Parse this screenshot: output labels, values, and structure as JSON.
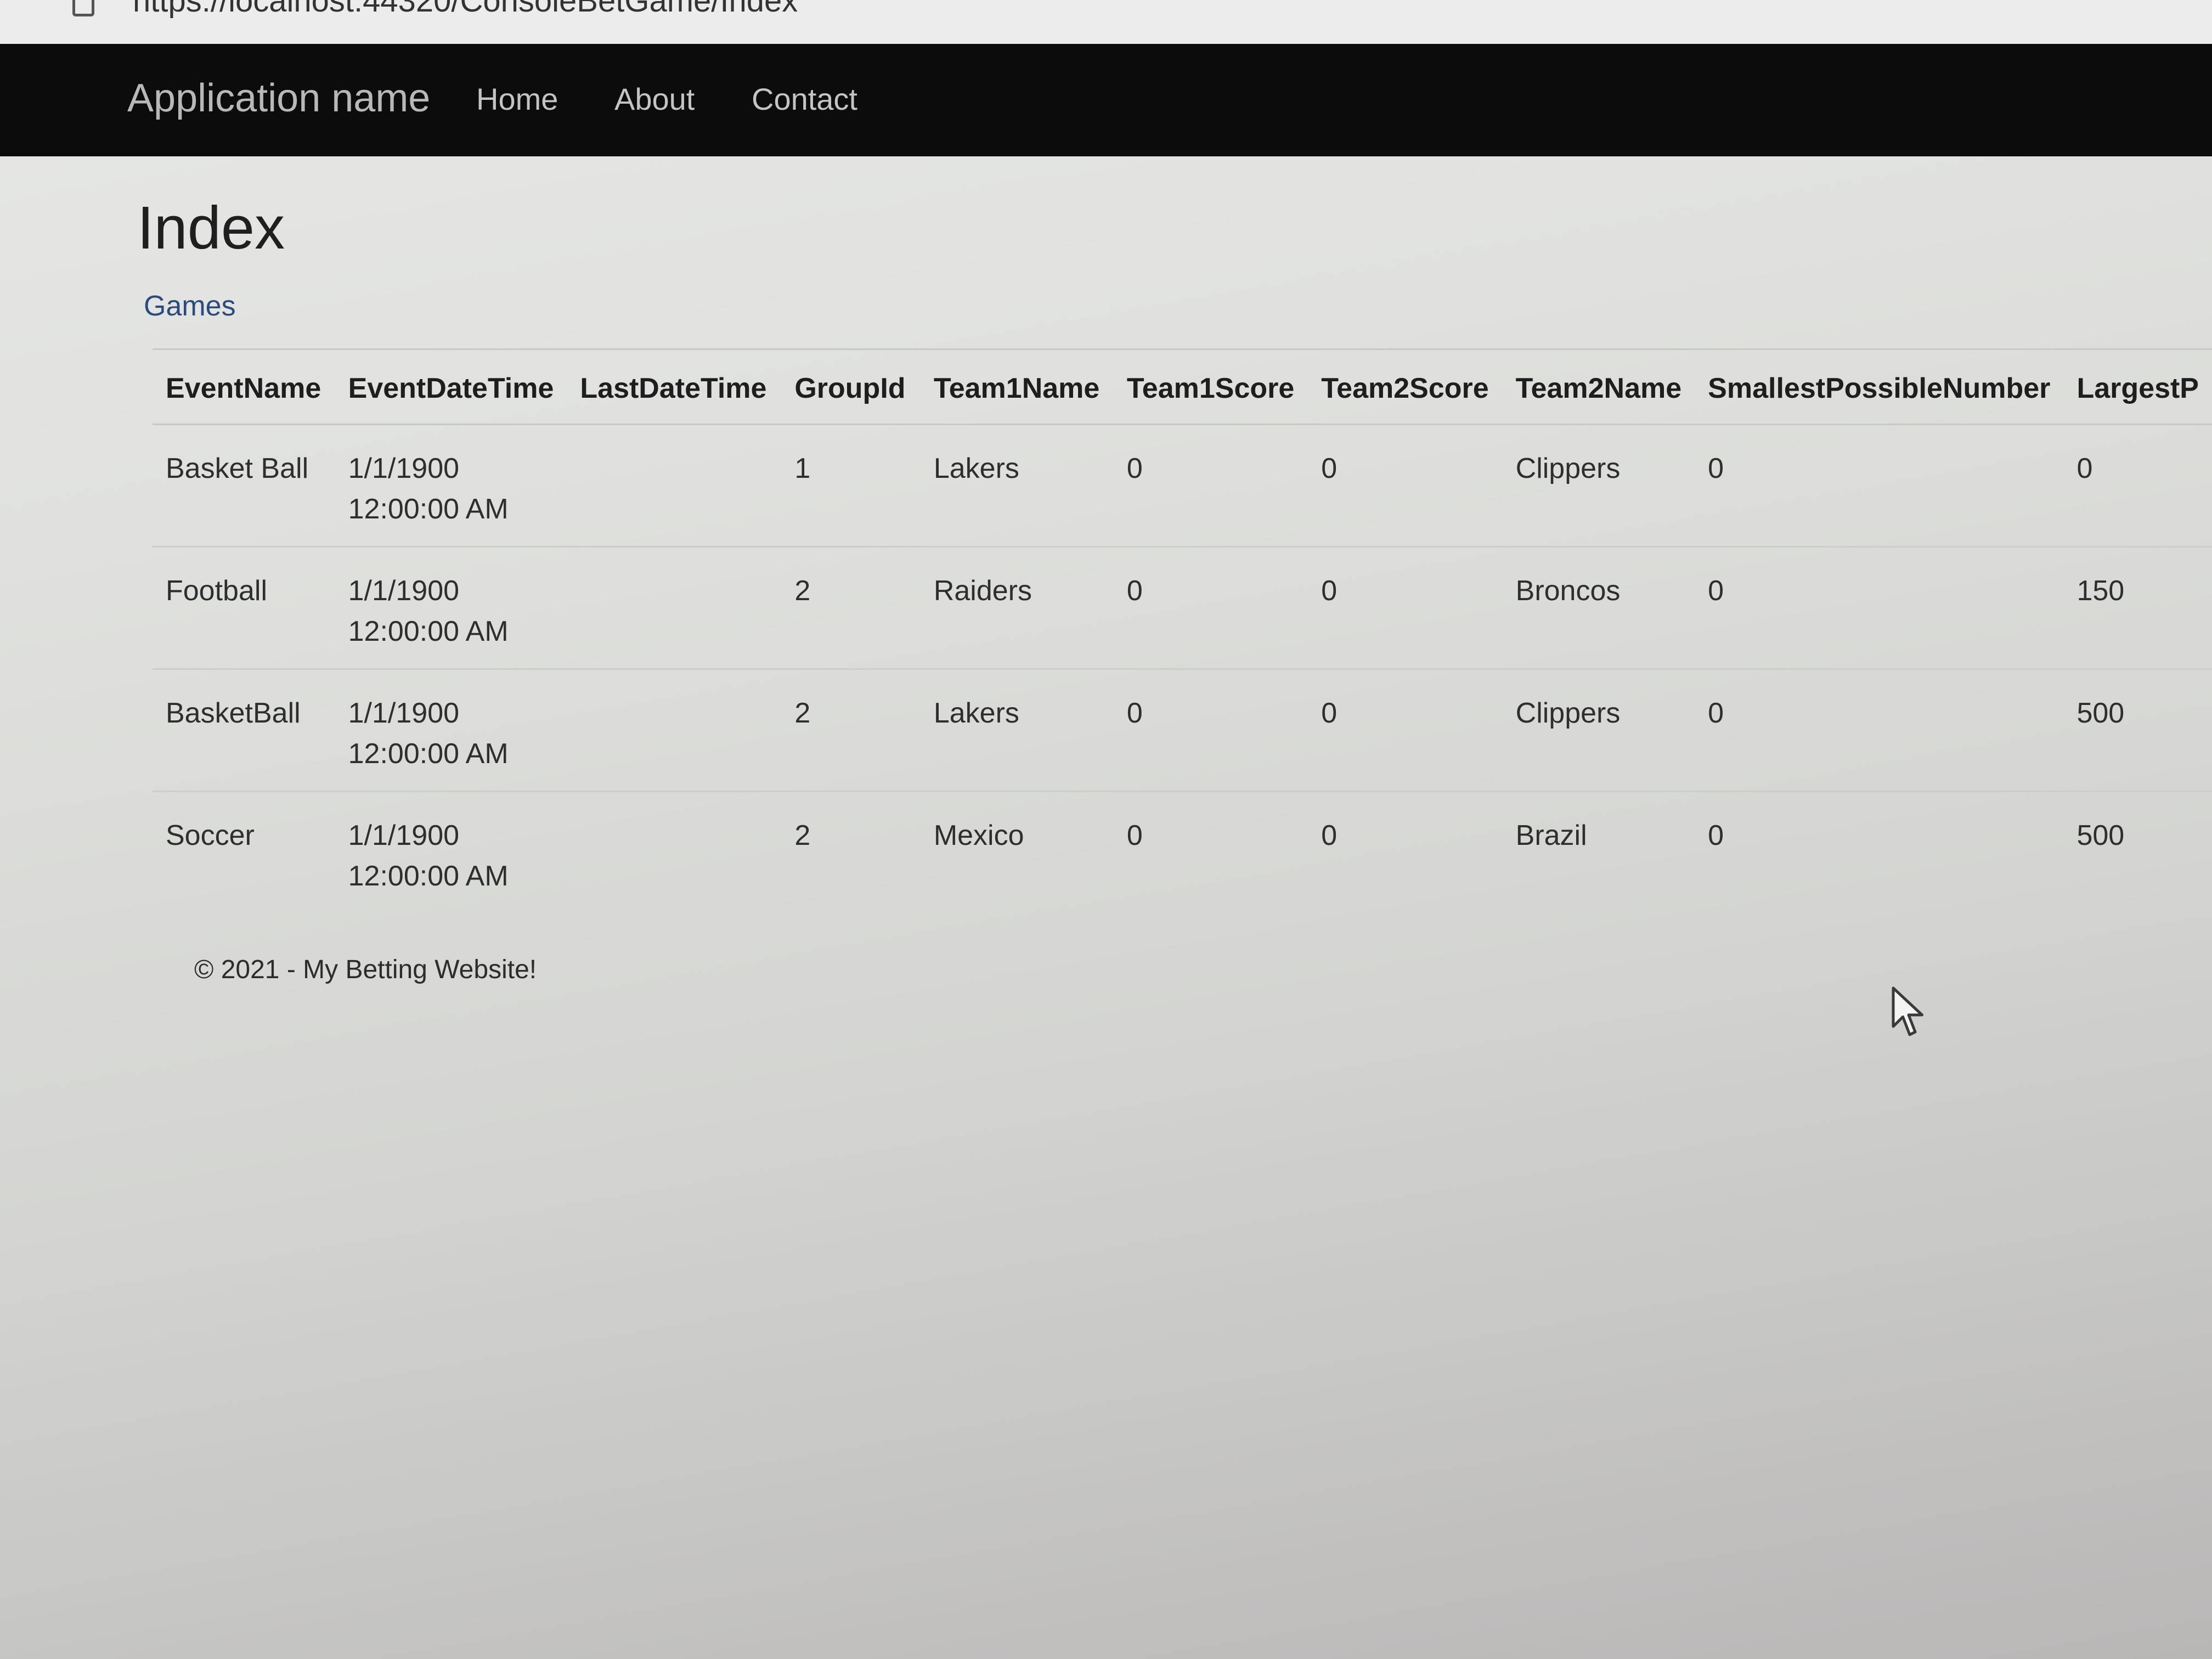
{
  "browser": {
    "url": "https://localhost:44320/ConsoleBetGame/Index"
  },
  "navbar": {
    "brand": "Application name",
    "links": [
      {
        "label": "Home"
      },
      {
        "label": "About"
      },
      {
        "label": "Contact"
      }
    ]
  },
  "page": {
    "title": "Index",
    "link_label": "Games"
  },
  "table": {
    "headers": [
      "EventName",
      "EventDateTime",
      "LastDateTime",
      "GroupId",
      "Team1Name",
      "Team1Score",
      "Team2Score",
      "Team2Name",
      "SmallestPossibleNumber",
      "LargestP"
    ],
    "rows": [
      {
        "event_name": "Basket Ball",
        "event_date": "1/1/1900",
        "event_time": "12:00:00 AM",
        "last_date_time": "",
        "group_id": "1",
        "team1_name": "Lakers",
        "team1_score": "0",
        "team2_score": "0",
        "team2_name": "Clippers",
        "smallest": "0",
        "largest": "0"
      },
      {
        "event_name": "Football",
        "event_date": "1/1/1900",
        "event_time": "12:00:00 AM",
        "last_date_time": "",
        "group_id": "2",
        "team1_name": "Raiders",
        "team1_score": "0",
        "team2_score": "0",
        "team2_name": "Broncos",
        "smallest": "0",
        "largest": "150"
      },
      {
        "event_name": "BasketBall",
        "event_date": "1/1/1900",
        "event_time": "12:00:00 AM",
        "last_date_time": "",
        "group_id": "2",
        "team1_name": "Lakers",
        "team1_score": "0",
        "team2_score": "0",
        "team2_name": "Clippers",
        "smallest": "0",
        "largest": "500"
      },
      {
        "event_name": "Soccer",
        "event_date": "1/1/1900",
        "event_time": "12:00:00 AM",
        "last_date_time": "",
        "group_id": "2",
        "team1_name": "Mexico",
        "team1_score": "0",
        "team2_score": "0",
        "team2_name": "Brazil",
        "smallest": "0",
        "largest": "500"
      }
    ]
  },
  "footer": {
    "text": "© 2021 - My Betting Website!"
  },
  "icons": {
    "page_icon": "page-info-icon",
    "cursor": "mouse-pointer-icon"
  },
  "colors": {
    "navbar_bg": "#0c0c0c",
    "link": "#2a4b7c"
  }
}
